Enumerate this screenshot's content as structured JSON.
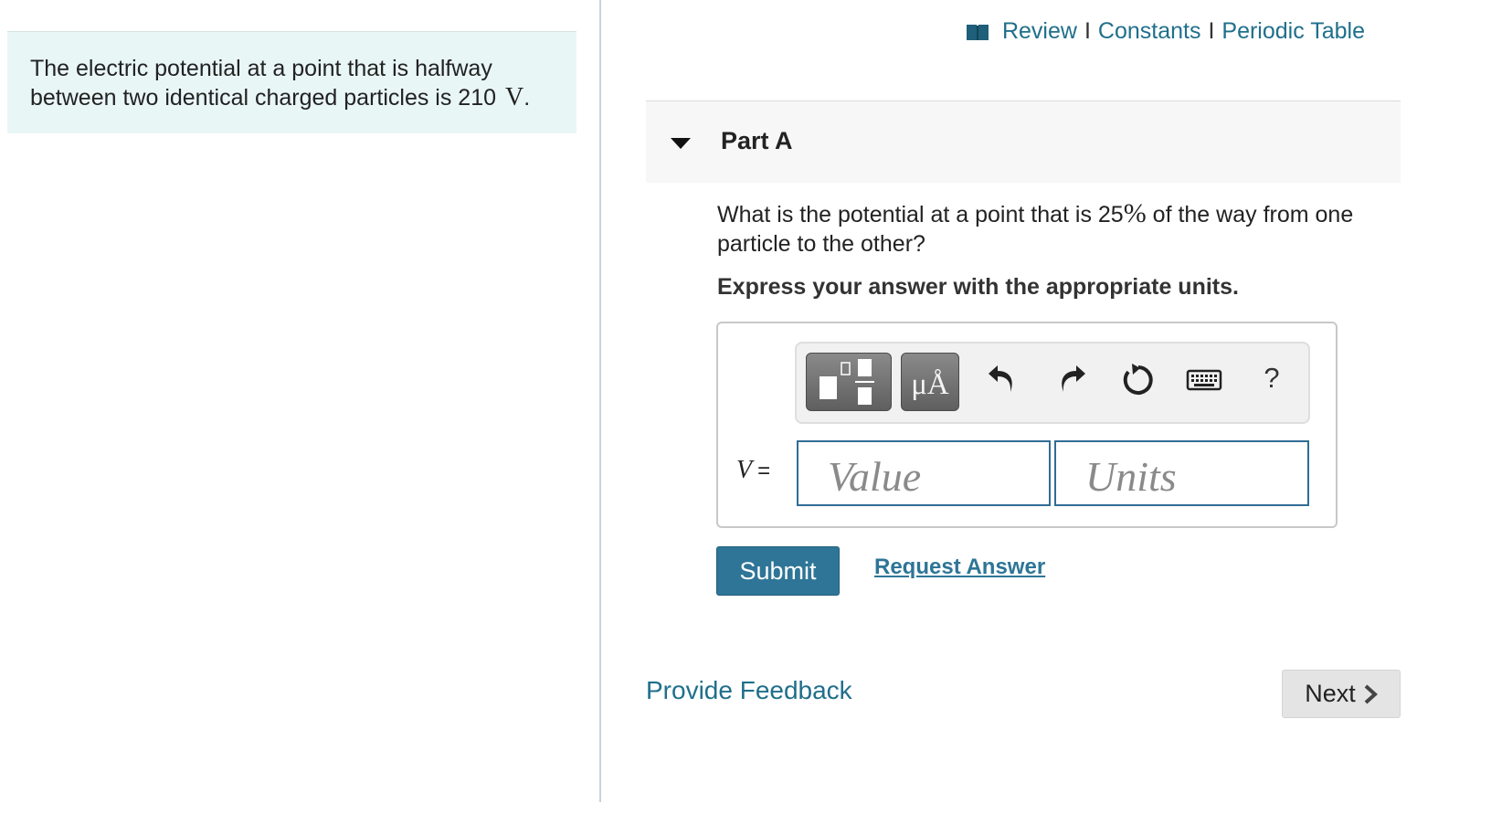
{
  "intro": {
    "text": "The electric potential at a point that is halfway between two identical charged particles is 210",
    "unit": "V",
    "period": "."
  },
  "top_links": {
    "review": "Review",
    "constants": "Constants",
    "periodic_table": "Periodic Table",
    "separator": "I"
  },
  "part": {
    "title": "Part A"
  },
  "question": {
    "text_before": "What is the potential at a point that is 25",
    "percent": "%",
    "text_after": " of the way from one particle to the other?",
    "instruction": "Express your answer with the appropriate units."
  },
  "toolbar": {
    "units_button_label": "μÅ",
    "help_label": "?"
  },
  "answer": {
    "variable": "V",
    "equals": "=",
    "value_placeholder": "Value",
    "units_placeholder": "Units"
  },
  "actions": {
    "submit_label": "Submit",
    "request_answer_label": "Request Answer",
    "feedback_label": "Provide Feedback",
    "next_label": "Next"
  },
  "colors": {
    "link": "#1f6f8b",
    "submit_bg": "#2e7597",
    "intro_bg": "#e9f6f6",
    "input_border": "#2f6d95"
  }
}
